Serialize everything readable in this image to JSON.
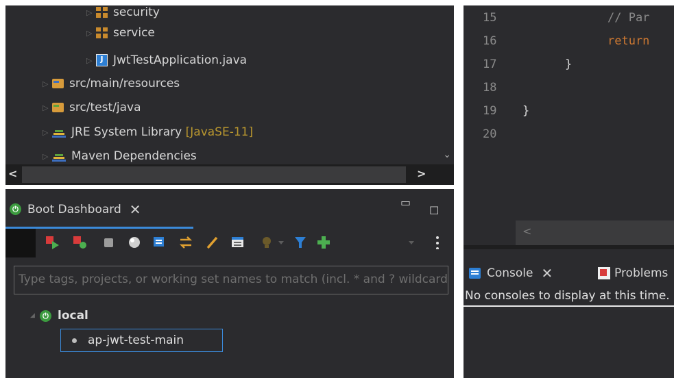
{
  "explorer": {
    "items": [
      {
        "label": "security",
        "icon": "package-icon"
      },
      {
        "label": "service",
        "icon": "package-icon"
      },
      {
        "label": "JwtTestApplication.java",
        "icon": "java-file-icon"
      },
      {
        "label": "src/main/resources",
        "icon": "source-folder-icon"
      },
      {
        "label": "src/test/java",
        "icon": "source-folder-icon"
      },
      {
        "label": "JRE System Library",
        "hint": "[JavaSE-11]",
        "icon": "library-icon"
      },
      {
        "label": "Maven Dependencies",
        "icon": "library-icon"
      }
    ],
    "scroll_left": "<",
    "scroll_right": ">",
    "scroll_down": "⌄"
  },
  "boot_dashboard": {
    "tab_label": "Boot Dashboard",
    "tab_close": "✕",
    "filter_placeholder": "Type tags, projects, or working set names to match (incl. * and ? wildcards)",
    "target": "local",
    "apps": [
      {
        "name": "ap-jwt-test-main",
        "status": "stopped"
      }
    ]
  },
  "editor": {
    "lines": [
      {
        "num": "15",
        "code": "// Par",
        "kind": "comment"
      },
      {
        "num": "16",
        "code": "return",
        "kind": "keyword"
      },
      {
        "num": "17",
        "code": "}",
        "kind": "plain"
      },
      {
        "num": "18",
        "code": "",
        "kind": "plain"
      },
      {
        "num": "19",
        "code": "}",
        "kind": "plain"
      },
      {
        "num": "20",
        "code": "",
        "kind": "plain"
      }
    ],
    "scroll_left": "<"
  },
  "console": {
    "tab_label": "Console",
    "tab_close": "✕",
    "problems_label": "Problems",
    "message": "No consoles to display at this time."
  },
  "colors": {
    "panel_bg": "#2b2b2e",
    "accent_blue": "#3b8ad9",
    "boot_green": "#3c9b3f",
    "comment": "#8a8a8a",
    "keyword": "#cc7832"
  }
}
